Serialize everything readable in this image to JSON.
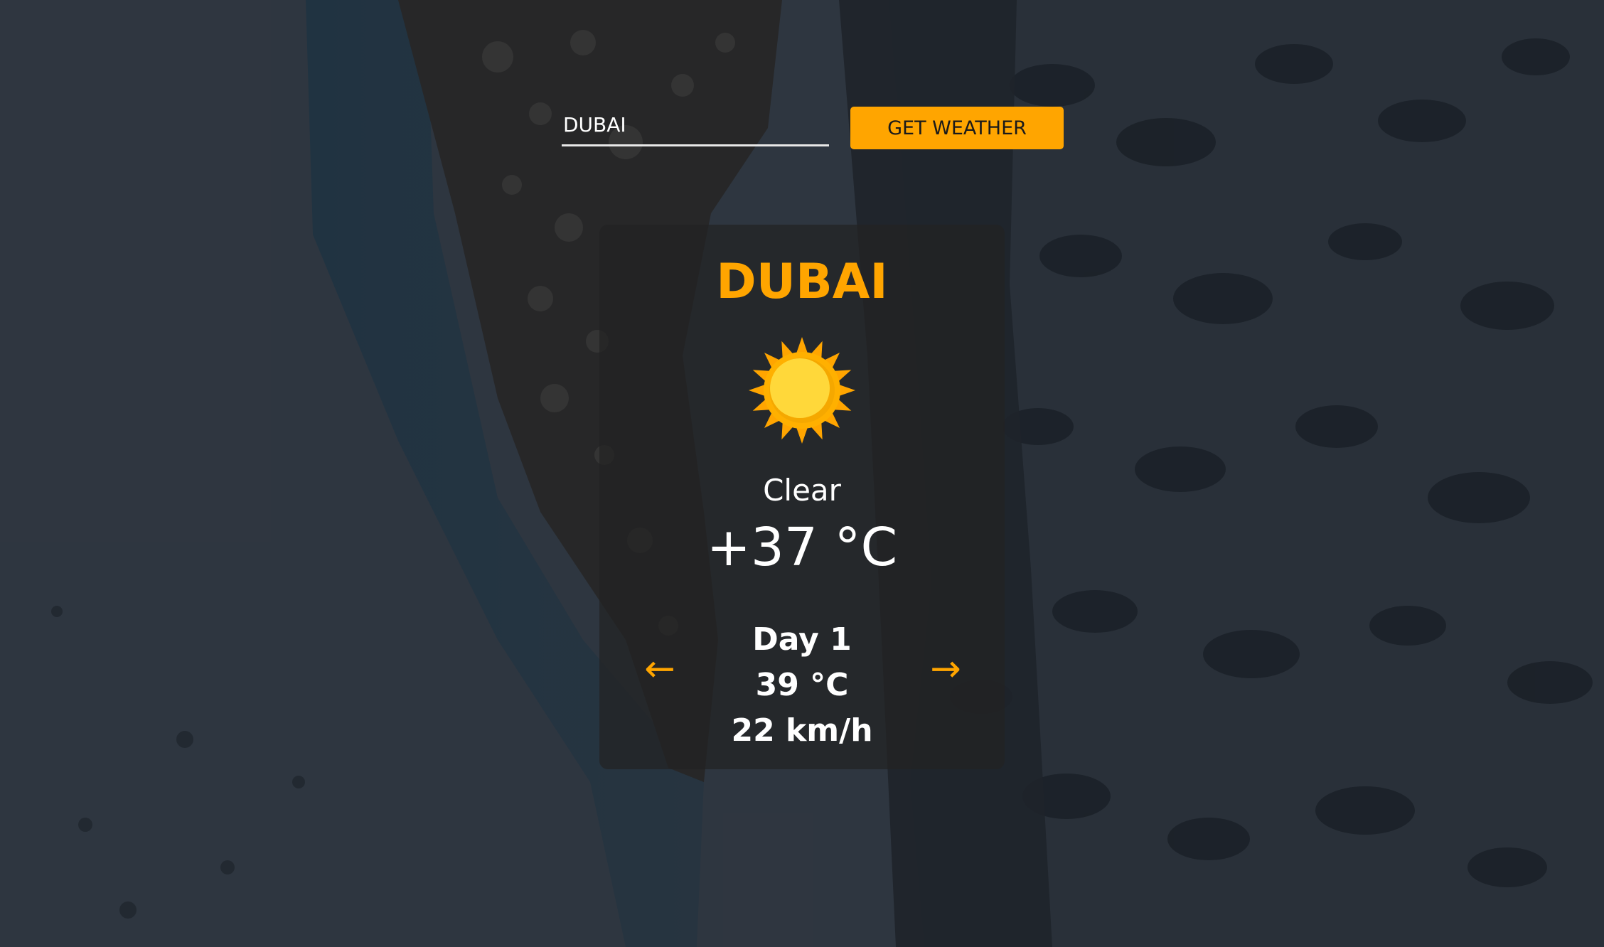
{
  "search": {
    "value": "DUBAI",
    "button_label": "GET WEATHER"
  },
  "weather": {
    "city": "DUBAI",
    "icon": "sun-icon",
    "condition": "Clear",
    "temperature": "+37 °C"
  },
  "forecast": {
    "day": "Day 1",
    "temperature": "39 °C",
    "wind": "22 km/h",
    "prev_arrow": "←",
    "next_arrow": "→"
  },
  "colors": {
    "accent": "#ffa500",
    "sun_core": "#ffd83a",
    "sun_rays": "#ffa500",
    "text": "#ffffff"
  }
}
